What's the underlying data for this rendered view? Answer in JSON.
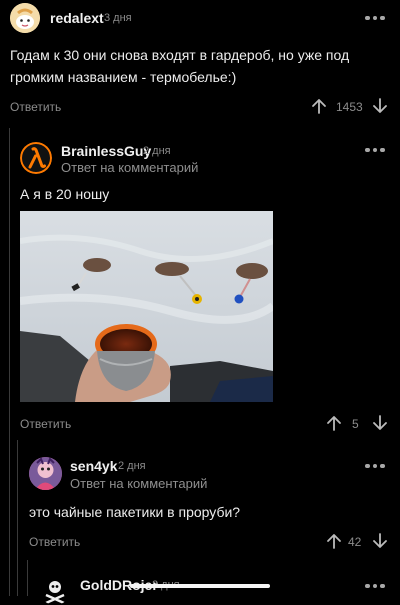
{
  "comments": [
    {
      "author": "redalext",
      "time": "3 дня",
      "text": "Годам к 30 они снова входят в гардероб, но уже под громким названием - термобелье:)",
      "reply_label": "Ответить",
      "votes": "1453"
    },
    {
      "author": "BrainlessGuy",
      "time": "2 дня",
      "subtitle": "Ответ на комментарий",
      "text": "А я в 20 ношу",
      "reply_label": "Ответить",
      "votes": "5"
    },
    {
      "author": "sen4yk",
      "time": "2 дня",
      "subtitle": "Ответ на комментарий",
      "text": "это чайные пакетики в проруби?",
      "reply_label": "Ответить",
      "votes": "42"
    },
    {
      "author": "GoldDRojer",
      "time": "2 дня"
    }
  ],
  "colors": {
    "background": "#000000",
    "text": "#ededed",
    "muted": "#8c8c8c",
    "thread": "#3a3a3a"
  }
}
